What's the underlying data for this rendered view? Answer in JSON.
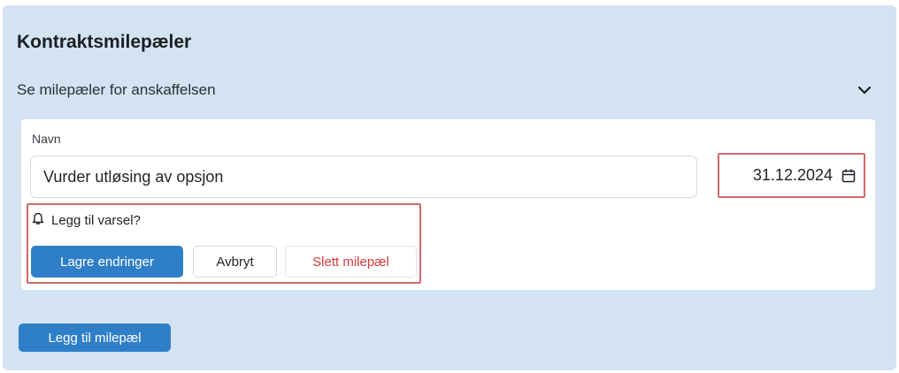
{
  "panel": {
    "title": "Kontraktsmilepæler",
    "subtitle": "Se milepæler for anskaffelsen",
    "toggle_icon": "chevron-down-icon"
  },
  "milestone": {
    "field_label": "Navn",
    "name_value": "Vurder utløsing av opsjon",
    "date_value": "31.12.2024",
    "date_icon": "calendar-icon",
    "alert_icon": "bell-icon",
    "alert_label": "Legg til varsel?",
    "save_label": "Lagre endringer",
    "cancel_label": "Avbryt",
    "delete_label": "Slett milepæl"
  },
  "add_button_label": "Legg til milepæl",
  "colors": {
    "panel_bg": "#d3e3f2",
    "primary": "#2f7fc8",
    "danger": "#d23b3b",
    "highlight": "#d06a6a"
  }
}
